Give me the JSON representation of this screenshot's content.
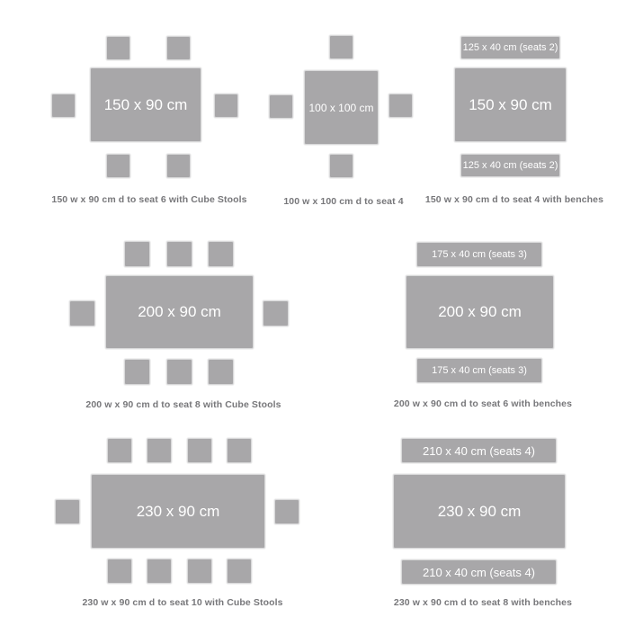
{
  "colors": {
    "furniture": "#a8a7a9",
    "caption": "#77777a",
    "background": "#ffffff"
  },
  "layouts": [
    {
      "table": "150 x 90 cm",
      "caption": "150 w x 90 cm d to seat 6 with Cube Stools"
    },
    {
      "table": "100 x 100 cm",
      "caption": "100 w x 100 cm d to seat 4"
    },
    {
      "table": "150 x 90 cm",
      "benches": [
        "125 x 40 cm (seats 2)",
        "125 x 40 cm (seats 2)"
      ],
      "caption": "150 w x 90 cm d to seat 4 with benches"
    },
    {
      "table": "200 x 90 cm",
      "caption": "200 w x 90 cm d to seat 8 with Cube Stools"
    },
    {
      "table": "200 x 90 cm",
      "benches": [
        "175 x 40 cm (seats 3)",
        "175 x 40 cm (seats 3)"
      ],
      "caption": "200 w x 90 cm d to seat 6 with benches"
    },
    {
      "table": "230 x 90 cm",
      "caption": "230 w x 90 cm d to seat 10 with Cube Stools"
    },
    {
      "table": "230 x 90 cm",
      "benches": [
        "210 x 40 cm (seats 4)",
        "210 x 40 cm (seats 4)"
      ],
      "caption": "230 w x 90 cm d to seat 8 with benches"
    }
  ]
}
